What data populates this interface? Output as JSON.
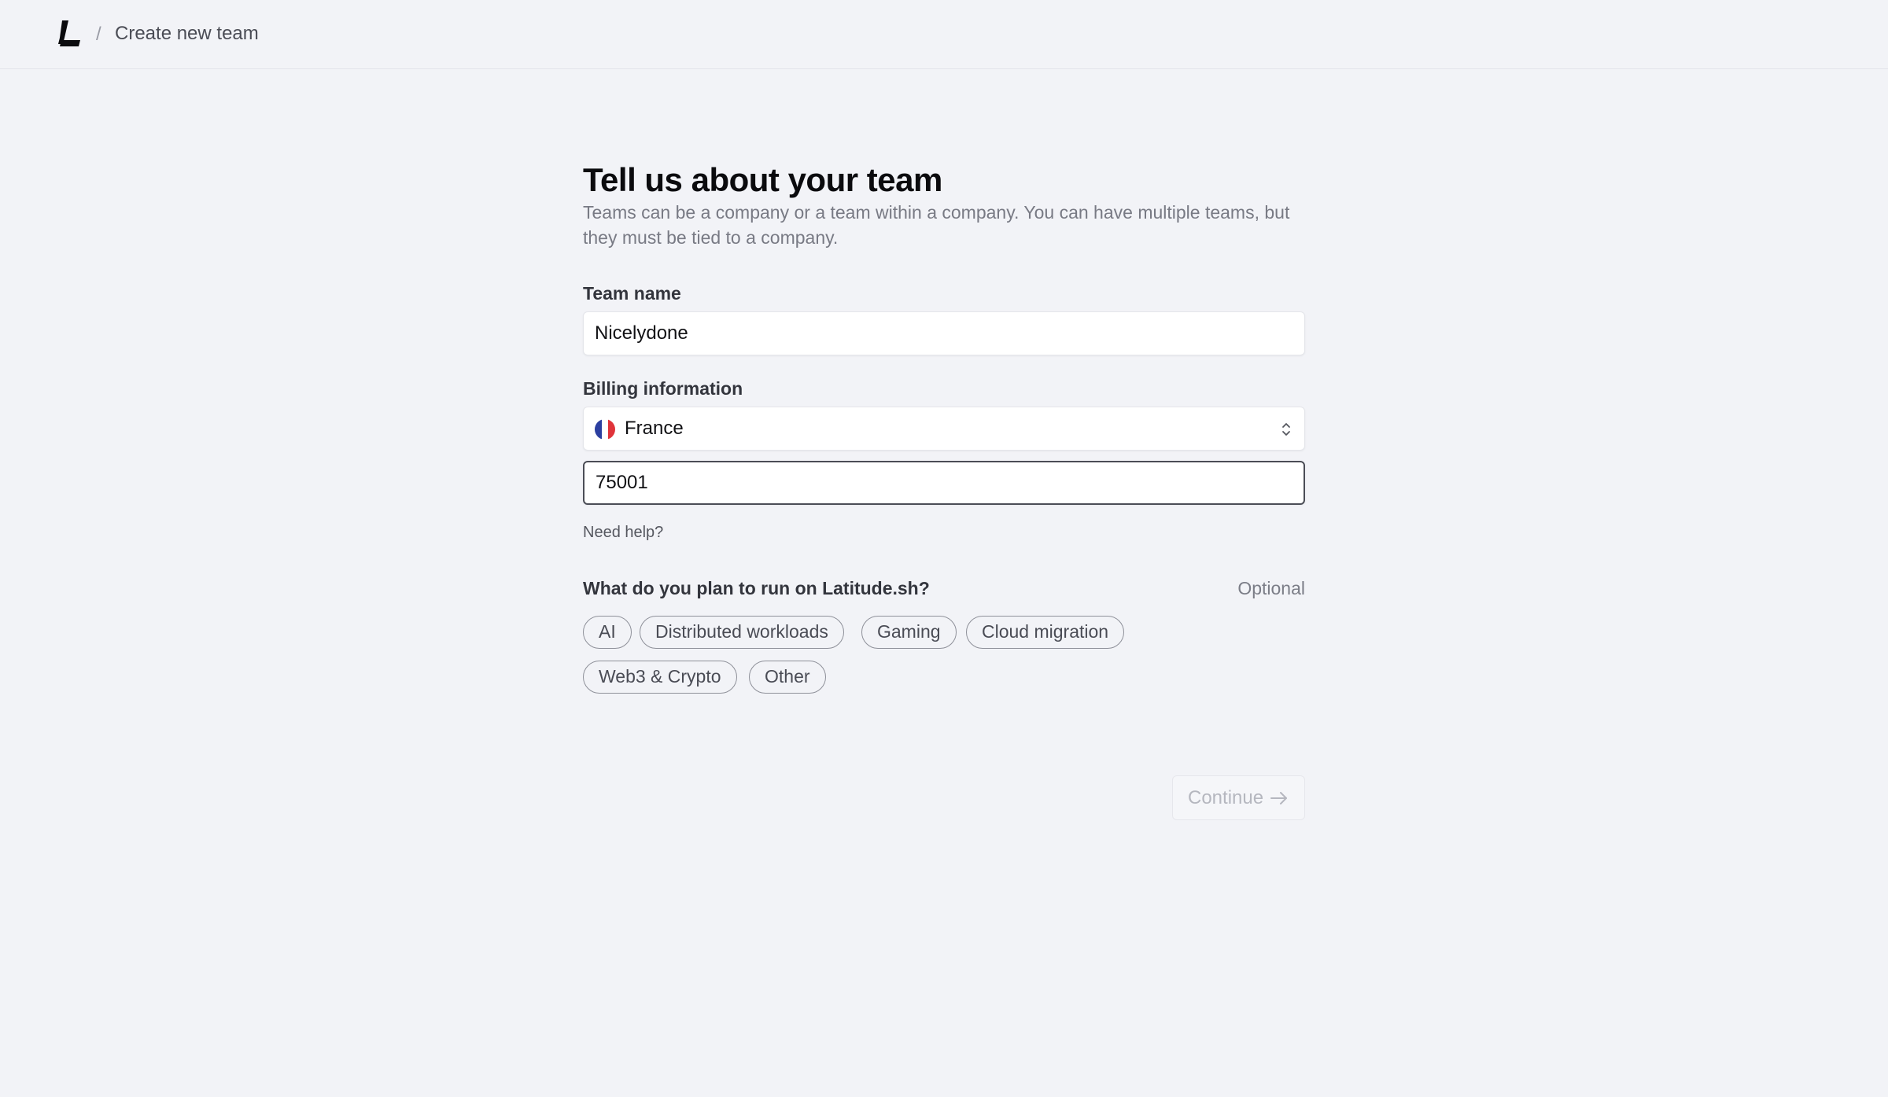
{
  "header": {
    "logo_icon": "latitude-logo-icon",
    "separator": "/",
    "page_title": "Create new team"
  },
  "form": {
    "heading": "Tell us about your team",
    "subtitle": "Teams can be a company or a team within a company. You can have multiple teams, but they must be tied to a company.",
    "team_name": {
      "label": "Team name",
      "value": "Nicelydone"
    },
    "billing": {
      "label": "Billing information",
      "country": "France",
      "flag_icon": "france-flag-icon",
      "postal_code": "75001"
    },
    "help_link": "Need help?",
    "plan": {
      "question": "What do you plan to run on Latitude.sh?",
      "optional": "Optional",
      "options": [
        "AI",
        "Distributed workloads",
        "Gaming",
        "Cloud migration",
        "Web3 & Crypto",
        "Other"
      ]
    },
    "continue_label": "Continue",
    "continue_icon": "arrow-right-icon"
  },
  "colors": {
    "background": "#f2f3f7",
    "heading": "#0b0b0e",
    "muted": "#787a84",
    "chip_border": "#8e9099",
    "disabled_text": "#b5b7bf",
    "flag_blue": "#2b3fa0",
    "flag_red": "#e0343a"
  }
}
